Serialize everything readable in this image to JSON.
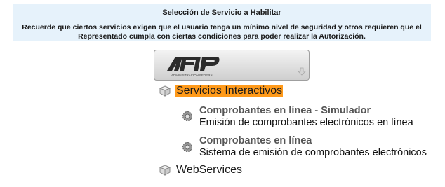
{
  "header": {
    "title": "Selección de Servicio a Habilitar",
    "message": "Recuerde que ciertos servicios exigen que el usuario tenga un mínimo nivel de seguridad y otros requieren que el Representado cumpla con ciertas condiciones para poder realizar la Autorización."
  },
  "logo": {
    "text": "AFIP",
    "subtext": "ADMINISTRACION FEDERAL",
    "icon": "down-arrow-icon"
  },
  "tree": {
    "servicios_interactivos": {
      "label": "Servicios Interactivos",
      "icon": "box-icon",
      "highlight": "#ff9a1a"
    },
    "items": [
      {
        "title": "Comprobantes en línea - Simulador",
        "description": "Emisión de comprobantes electrónicos en línea",
        "icon": "gear-icon"
      },
      {
        "title": "Comprobantes en línea",
        "description": "Sistema de emisión de comprobantes electrónicos",
        "icon": "gear-icon"
      }
    ],
    "webservices": {
      "label": "WebServices",
      "icon": "box-icon"
    }
  }
}
